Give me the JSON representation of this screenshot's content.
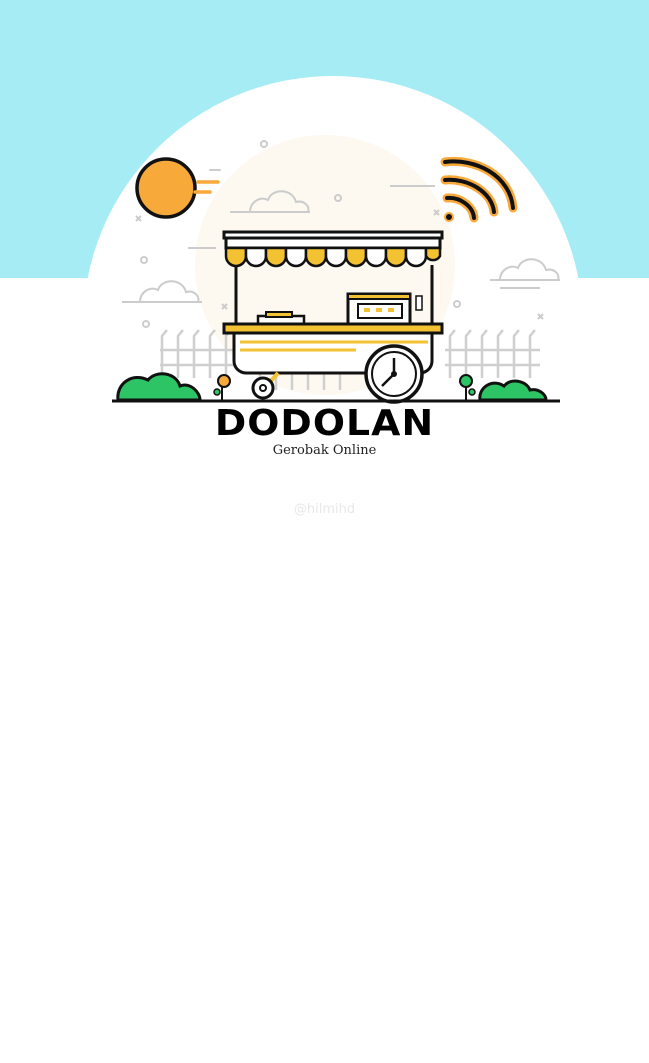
{
  "splash": {
    "app_name": "DODOLAN",
    "tagline": "Gerobak Online",
    "watermark": "@hilmihd"
  },
  "colors": {
    "sky": "#a6ecf5",
    "accent_yellow": "#f2c233",
    "sun_orange": "#f7a93a",
    "bush_green": "#2cc464",
    "line_black": "#111111"
  },
  "icons": [
    "sun-icon",
    "wifi-icon",
    "food-cart-icon",
    "cloud-icon",
    "bush-icon",
    "fence-icon"
  ]
}
